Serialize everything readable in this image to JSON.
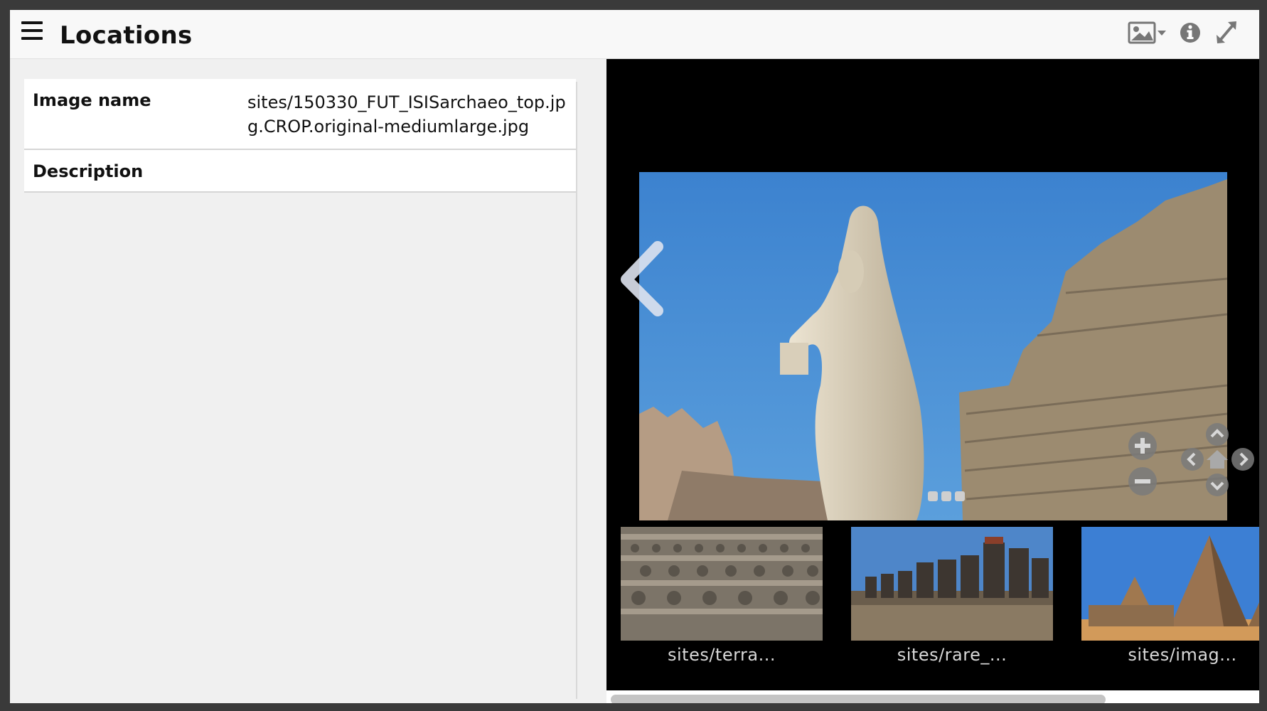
{
  "header": {
    "title": "Locations",
    "icons": [
      "menu-icon",
      "image-icon",
      "info-icon",
      "expand-icon"
    ]
  },
  "properties": [
    {
      "key": "Image name",
      "value": "sites/150330_FUT_ISISarchaeo_top.jpg.CROP.original-mediumlarge.jpg"
    },
    {
      "key": "Description",
      "value": ""
    }
  ],
  "viewer": {
    "nav_icons": [
      "chevron-left-icon",
      "zoom-in-icon",
      "zoom-out-icon",
      "pan-up-icon",
      "pan-left-icon",
      "home-icon",
      "pan-right-icon",
      "pan-down-icon"
    ],
    "thumbnails": [
      {
        "label": "sites/terra..."
      },
      {
        "label": "sites/rare_..."
      },
      {
        "label": "sites/imag..."
      }
    ],
    "colors": {
      "background": "#000000",
      "sky": "#3f86cf",
      "stone": "#b5a185"
    }
  }
}
